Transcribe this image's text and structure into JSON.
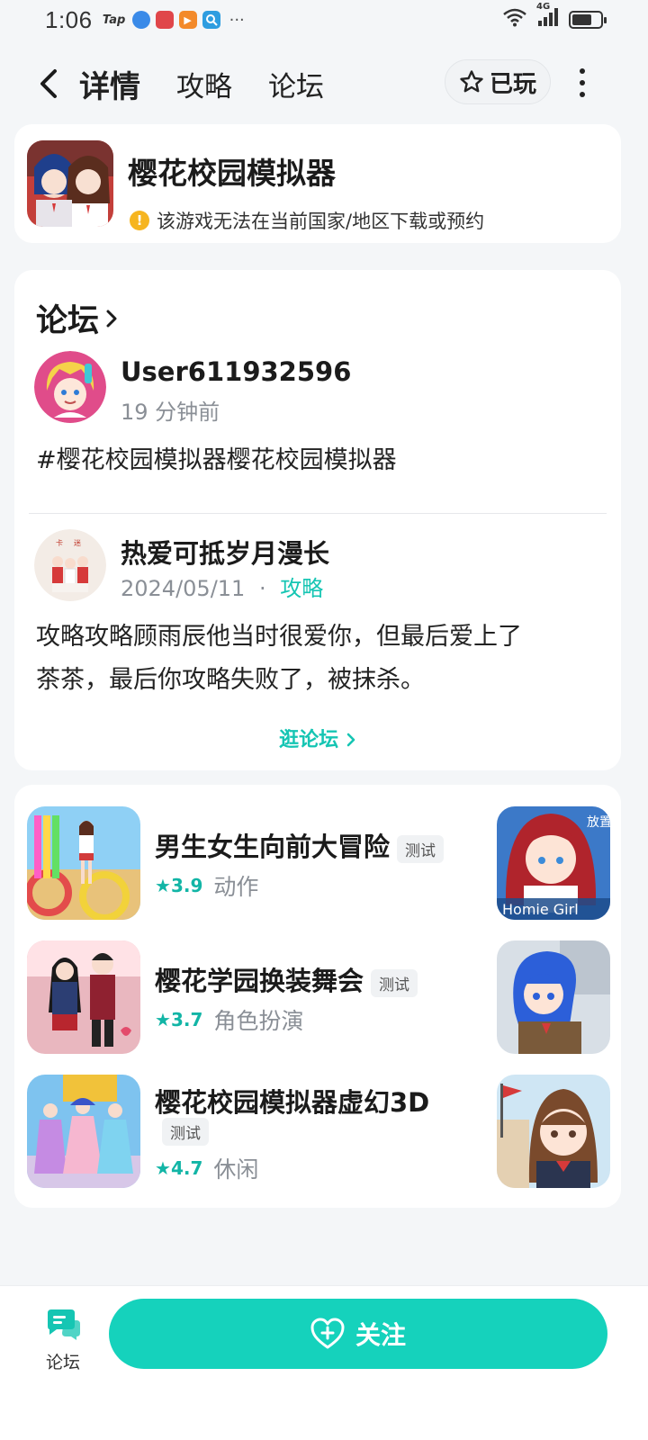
{
  "status_bar": {
    "time": "1:06",
    "app_badge": "Tap",
    "network": "4G",
    "battery_level": 0.7
  },
  "nav": {
    "tabs": [
      "详情",
      "攻略",
      "论坛"
    ],
    "active_tab_index": 0,
    "played_label": "已玩"
  },
  "game": {
    "title": "樱花校园模拟器",
    "notice": "该游戏无法在当前国家/地区下载或预约"
  },
  "forum": {
    "heading": "论坛",
    "posts": [
      {
        "username": "User611932596",
        "time": "19 分钟前",
        "content": "#樱花校园模拟器樱花校园模拟器"
      },
      {
        "username": "热爱可抵岁月漫长",
        "time": "2024/05/11",
        "separator": "·",
        "category": "攻略",
        "content_line1": "攻略攻略顾雨辰他当时很爱你，但最后爱上了",
        "content_line2": "茶茶，最后你攻略失败了，被抹杀。"
      }
    ],
    "browse_label": "逛论坛"
  },
  "recommendations": [
    {
      "title": "男生女生向前大冒险",
      "badge": "测试",
      "rating": "3.9",
      "genre": "动作"
    },
    {
      "title": "樱花学园换装舞会",
      "badge": "测试",
      "rating": "3.7",
      "genre": "角色扮演"
    },
    {
      "title": "樱花校园模拟器虚幻3D",
      "badge": "测试",
      "rating": "4.7",
      "genre": "休闲"
    }
  ],
  "side_thumb_text": {
    "homie_label": "Homie Girl",
    "corner_tag": "放置"
  },
  "bottom_bar": {
    "forum_label": "论坛",
    "follow_label": "关注"
  },
  "colors": {
    "accent": "#15c5b3",
    "follow_button": "#15d2bc",
    "warning": "#f6b520"
  }
}
